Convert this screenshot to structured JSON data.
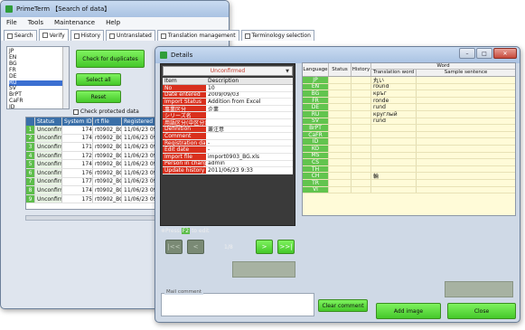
{
  "main_window": {
    "title": "PrimeTerm 【Search of data】",
    "menu": [
      "File",
      "Tools",
      "Maintenance",
      "Help"
    ],
    "tabs": [
      "Search",
      "Verify",
      "History",
      "Untranslated",
      "Translation management",
      "Terminology selection"
    ],
    "languages": [
      "JP",
      "EN",
      "BG",
      "FR",
      "DE",
      "RU",
      "SV",
      "BrPT",
      "CaFR",
      "ID"
    ],
    "selected_language": "RU",
    "buttons": {
      "check_duplicates": "Check for duplicates",
      "select_all": "Select all",
      "reset": "Reset"
    },
    "check_protected_label": "Check protected data",
    "table_headers": [
      "",
      "Status",
      "System ID",
      "rt file",
      "Registered dat"
    ],
    "rows": [
      {
        "n": "1",
        "status": "Unconfirmed",
        "id": "174",
        "file": "rt0902_BG",
        "date": "11/06/23 09:3"
      },
      {
        "n": "2",
        "status": "Unconfirmed",
        "id": "174",
        "file": "rt0902_BG",
        "date": "11/06/23 09:3"
      },
      {
        "n": "3",
        "status": "Unconfirmed",
        "id": "171",
        "file": "rt0902_BG",
        "date": "11/06/23 09:3"
      },
      {
        "n": "4",
        "status": "Unconfirmed",
        "id": "172",
        "file": "rt0902_BG",
        "date": "11/06/23 09:3"
      },
      {
        "n": "5",
        "status": "Unconfirmed",
        "id": "174",
        "file": "rt0902_BG",
        "date": "11/06/23 09:3"
      },
      {
        "n": "6",
        "status": "Unconfirmed",
        "id": "176",
        "file": "rt0902_BG",
        "date": "11/06/23 09:3"
      },
      {
        "n": "7",
        "status": "Unconfirmed",
        "id": "177",
        "file": "rt0902_BG",
        "date": "11/06/23 09:3"
      },
      {
        "n": "8",
        "status": "Unconfirmed",
        "id": "174",
        "file": "rt0902_BG",
        "date": "11/06/23 09:3"
      },
      {
        "n": "9",
        "status": "Unconfirmed",
        "id": "175",
        "file": "rt0902_BG",
        "date": "11/06/23 09:3"
      }
    ]
  },
  "details": {
    "title": "Details",
    "status": "Unconfirmed",
    "prop_headers": [
      "Item",
      "Description"
    ],
    "props": [
      {
        "k": "No",
        "v": "10"
      },
      {
        "k": "Date entered",
        "v": "2009/09/03"
      },
      {
        "k": "Import Status",
        "v": "Addition from Excel"
      },
      {
        "k": "事業区分",
        "v": "企業"
      },
      {
        "k": "シリーズ名",
        "v": ""
      },
      {
        "k": "用語区分(中区分)",
        "v": ""
      },
      {
        "k": "Definition",
        "v": "叢注意"
      },
      {
        "k": "Comment",
        "v": ""
      },
      {
        "k": "Registration day",
        "v": "-"
      },
      {
        "k": "Edit date",
        "v": "-"
      },
      {
        "k": "Import file",
        "v": "import0903_BG.xls"
      },
      {
        "k": "Person in charge",
        "v": "admin"
      },
      {
        "k": "Update history",
        "v": "2011/06/23 9:33"
      }
    ],
    "press_hint_pre": "※Press",
    "press_key": "F2",
    "press_hint_post": "to edit",
    "page_indicator": "1/8",
    "nav": {
      "first": "|<<",
      "prev": "<",
      "next": ">",
      "last": ">>|"
    },
    "lang_headers": {
      "language": "Language",
      "status": "Status",
      "history": "History",
      "word": "Word",
      "translation_word": "Translation word",
      "sample_sentence": "Sample sentence"
    },
    "lang_rows": [
      {
        "lang": "JP",
        "word": "丸い"
      },
      {
        "lang": "EN",
        "word": "round"
      },
      {
        "lang": "BG",
        "word": "кръг"
      },
      {
        "lang": "FR",
        "word": "ronde"
      },
      {
        "lang": "DE",
        "word": "rund"
      },
      {
        "lang": "RU",
        "word": "круглый"
      },
      {
        "lang": "SV",
        "word": "rund"
      },
      {
        "lang": "BrPT",
        "word": ""
      },
      {
        "lang": "CaFR",
        "word": ""
      },
      {
        "lang": "ID",
        "word": ""
      },
      {
        "lang": "KO",
        "word": ""
      },
      {
        "lang": "MS",
        "word": ""
      },
      {
        "lang": "CS",
        "word": ""
      },
      {
        "lang": "TH",
        "word": ""
      },
      {
        "lang": "CH",
        "word": "輪"
      },
      {
        "lang": "TR",
        "word": ""
      },
      {
        "lang": "VI",
        "word": ""
      }
    ],
    "mail_comment_label": "Mail comment",
    "buttons": {
      "clear_comment": "Clear comment",
      "add_image": "Add image",
      "close": "Close"
    }
  }
}
